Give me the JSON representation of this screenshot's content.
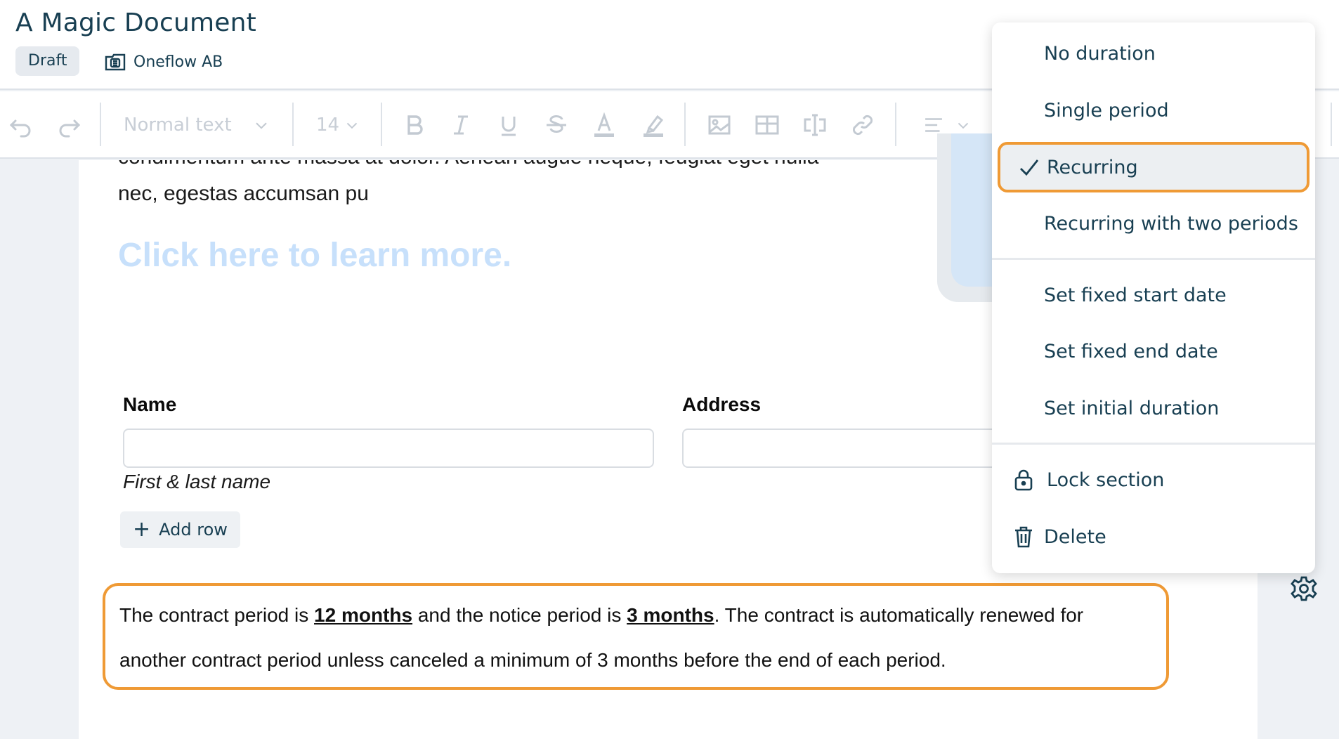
{
  "header": {
    "title": "A Magic Document",
    "status": "Draft",
    "company": "Oneflow AB"
  },
  "toolbar": {
    "text_style": "Normal text",
    "font_size": "14",
    "icons": [
      "undo-icon",
      "redo-icon",
      "bold-icon",
      "italic-icon",
      "underline-icon",
      "strikethrough-icon",
      "text-color-icon",
      "highlight-icon",
      "image-icon",
      "table-icon",
      "text-field-icon",
      "link-icon",
      "align-icon"
    ]
  },
  "document": {
    "paragraph_cut": "condimentum ante massa at dolor. Aenean augue neque, feugiat eget nulla",
    "paragraph_end": "nec, egestas accumsan pu",
    "learn_more": "Click here to learn more.",
    "form": {
      "name_label": "Name",
      "name_value": "",
      "name_hint": "First & last name",
      "address_label": "Address",
      "address_value": "",
      "add_row": "Add row"
    },
    "duration": {
      "text_1": "The contract period is ",
      "contract_period": "12 months",
      "text_2": " and the notice period is ",
      "notice_period": "3 months",
      "text_3": ". The contract is automatically renewed for another contract period unless canceled a minimum of 3 months before the end of each period."
    }
  },
  "menu": {
    "group1": [
      "No duration",
      "Single period",
      "Recurring",
      "Recurring with two periods"
    ],
    "selected": "Recurring",
    "group2": [
      "Set fixed start date",
      "Set fixed end date",
      "Set initial duration"
    ],
    "lock": "Lock section",
    "delete": "Delete"
  },
  "colors": {
    "accent_orange": "#ef9a35",
    "text_dark": "#183f52",
    "link_light": "#c7e0fb"
  }
}
